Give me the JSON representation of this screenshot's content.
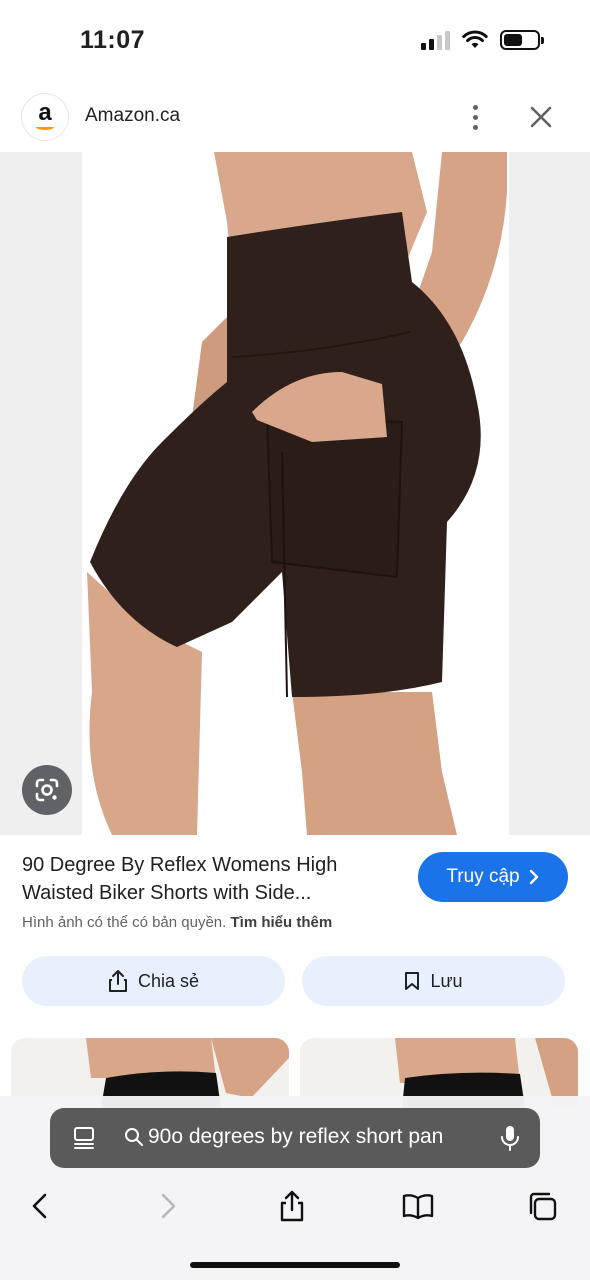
{
  "status_bar": {
    "time": "11:07"
  },
  "site": {
    "logo_letter": "a",
    "name": "Amazon.ca"
  },
  "product": {
    "title": "90 Degree By Reflex Womens High Waisted Biker Shorts with Side...",
    "visit_label": "Truy cập",
    "copyright_notice": "Hình ảnh có thể có bản quyền.",
    "learn_more_label": "Tìm hiểu thêm"
  },
  "actions": {
    "share_label": "Chia sẻ",
    "save_label": "Lưu"
  },
  "browser": {
    "search_text": "90o degrees by reflex short pan"
  },
  "colors": {
    "accent": "#1a73e8",
    "shorts": "#2f201b",
    "action_bg": "#e8f0fe"
  },
  "icons": {
    "site_logo": "amazon-logo",
    "more": "more-vert-icon",
    "close": "close-icon",
    "lens": "google-lens-icon",
    "visit": "chevron-right-icon",
    "share": "share-icon",
    "save": "bookmark-icon",
    "page": "page-menu-icon",
    "search": "search-icon",
    "mic": "microphone-icon",
    "back": "back-icon",
    "forward": "forward-icon",
    "toolbar_share": "share-icon",
    "bookmarks": "book-icon",
    "tabs": "tabs-icon"
  }
}
